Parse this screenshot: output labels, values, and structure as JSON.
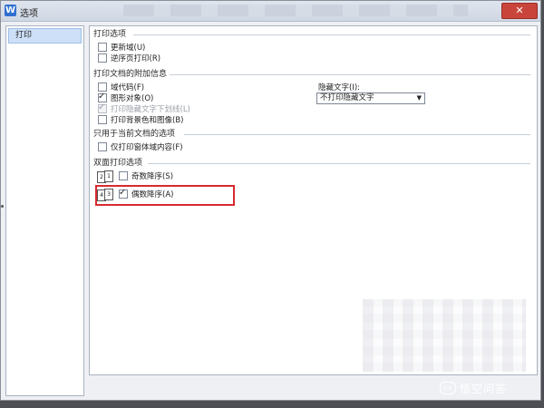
{
  "window": {
    "icon_letter": "W",
    "title": "选项",
    "close_glyph": "✕"
  },
  "sidebar": {
    "items": [
      {
        "label": "打印",
        "selected": true
      }
    ]
  },
  "print_options": {
    "title": "打印选项",
    "update_fields": {
      "label": "更新域(U)",
      "checked": false
    },
    "reverse_order": {
      "label": "逆序页打印(R)",
      "checked": false
    }
  },
  "print_extra": {
    "title": "打印文档的附加信息",
    "field_codes": {
      "label": "域代码(F)",
      "checked": false
    },
    "drawing_objects": {
      "label": "图形对象(O)",
      "checked": true
    },
    "hidden_underline": {
      "label": "打印隐藏文字下划线(L)",
      "checked": true,
      "disabled": true
    },
    "background": {
      "label": "打印背景色和图像(B)",
      "checked": false
    },
    "hidden_text_label": "隐藏文字(I):",
    "hidden_text_value": "不打印隐藏文字",
    "dropdown_arrow": "▼"
  },
  "current_doc": {
    "title": "只用于当前文档的选项",
    "form_data_only": {
      "label": "仅打印窗体域内容(F)",
      "checked": false
    }
  },
  "duplex": {
    "title": "双面打印选项",
    "odd_reverse": {
      "label": "奇数降序(S)",
      "checked": false,
      "page_front": "2",
      "page_back": "1"
    },
    "even_reverse": {
      "label": "偶数降序(A)",
      "checked": true,
      "page_front": "4",
      "page_back": "3"
    }
  },
  "check_glyph": "✓",
  "watermark": {
    "text": "悟空问答"
  },
  "colors": {
    "highlight": "#d8292f",
    "selection": "#cde0f7",
    "close": "#c9453b"
  }
}
